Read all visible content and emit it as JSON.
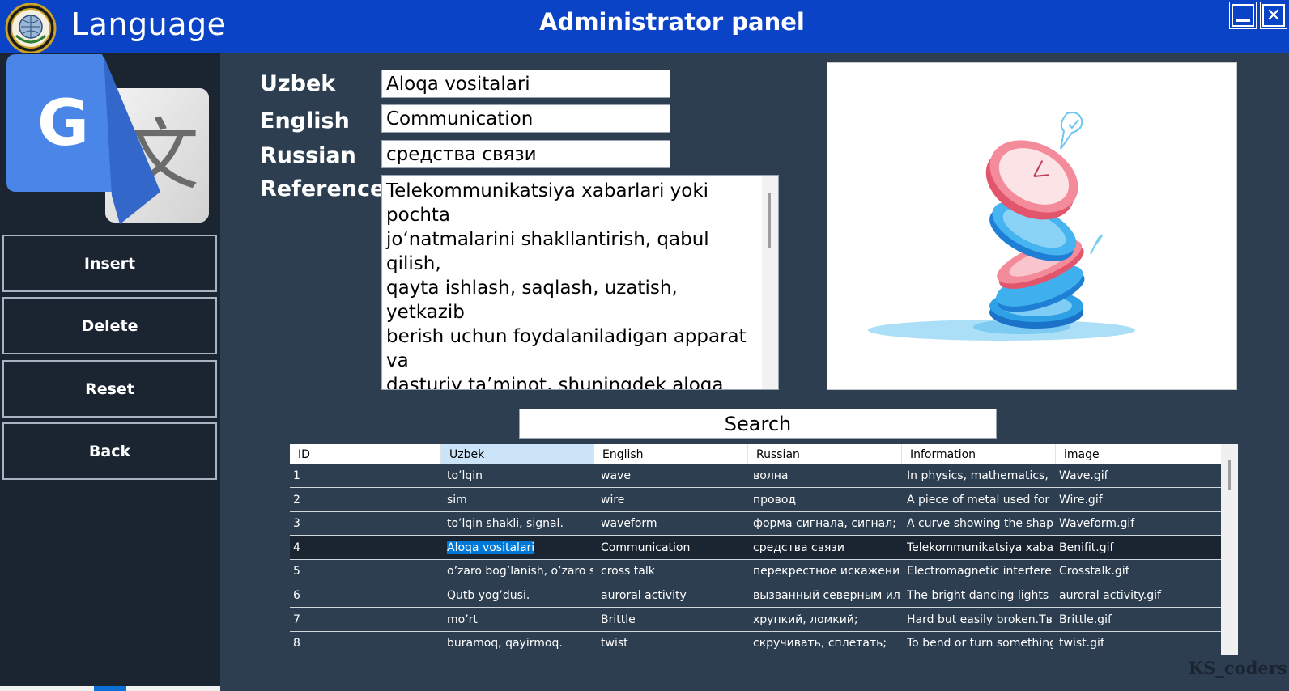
{
  "header": {
    "app_title": "Language",
    "panel_title": "Administrator panel",
    "minimize_icon": "minimize-icon",
    "close_icon": "close-icon"
  },
  "sidebar": {
    "logo_icon": "google-translate-icon",
    "buttons": [
      {
        "label": "Insert"
      },
      {
        "label": "Delete"
      },
      {
        "label": "Reset"
      },
      {
        "label": "Back"
      }
    ]
  },
  "form": {
    "uzbek_label": "Uzbek",
    "english_label": "English",
    "russian_label": "Russian",
    "reference_label": "Reference",
    "uzbek_value": "Aloqa vositalari",
    "english_value": "Communication",
    "russian_value": "средства связи",
    "reference_value": "Telekommunikatsiya xabarlari yoki pochta\njo‘natmalarini shakllantirish, qabul qilish,\nqayta ishlash, saqlash, uzatish, yetkazib\nberish uchun foydalaniladigan apparat va\ndasturiy ta’minot, shuningdek aloqa\nxizmatlarini ko‘rsatish yoki aloqa tarmoqlarini\nishlatishda foydalaniladigan boshqa apparat\nva dasturiy vositalar.\nингл: communication tools"
  },
  "search": {
    "label": "Search"
  },
  "table": {
    "columns": [
      "ID",
      "Uzbek",
      "English",
      "Russian",
      "Information",
      "image"
    ],
    "selected_row": 3,
    "rows": [
      [
        "1",
        "to’lqin",
        "wave",
        "волна",
        "In physics, mathematics, a...",
        "Wave.gif"
      ],
      [
        "2",
        "sim",
        "wire",
        "провод",
        "A piece of metal used for c...",
        "Wire.gif"
      ],
      [
        "3",
        "to’lqin shakli, signal.",
        "waveform",
        "форма сигнала, сигнал;",
        "A curve showing the shape ...",
        "Waveform.gif"
      ],
      [
        "4",
        "Aloqa vositalari",
        "Communication",
        "средства связи",
        "Telekommunikatsiya xabar...",
        "Benifit.gif"
      ],
      [
        "5",
        "o’zaro bog’lanish, o’zaro s...",
        "cross talk",
        "перекрестное искажение...",
        "Electromagnetic interferen...",
        "Crosstalk.gif"
      ],
      [
        "6",
        "Qutb yog’dusi.",
        "auroral activity",
        "вызванный северным ил...",
        "The bright dancing lights o...",
        "auroral activity.gif"
      ],
      [
        "7",
        "mo’rt",
        "Brittle",
        "хрупкий, ломкий;",
        "Hard but easily broken.Tве...",
        "Brittle.gif"
      ],
      [
        "8",
        "buramoq, qayirmoq.",
        "twist",
        "скручивать, сплетать;",
        "To bend or turn something...",
        "twist.gif"
      ]
    ]
  },
  "watermark": "KS_coders",
  "colors": {
    "titlebar": "#0a43c6",
    "sidebar": "#1b2431",
    "main": "#2c3e50",
    "selection": "#0078d7"
  }
}
